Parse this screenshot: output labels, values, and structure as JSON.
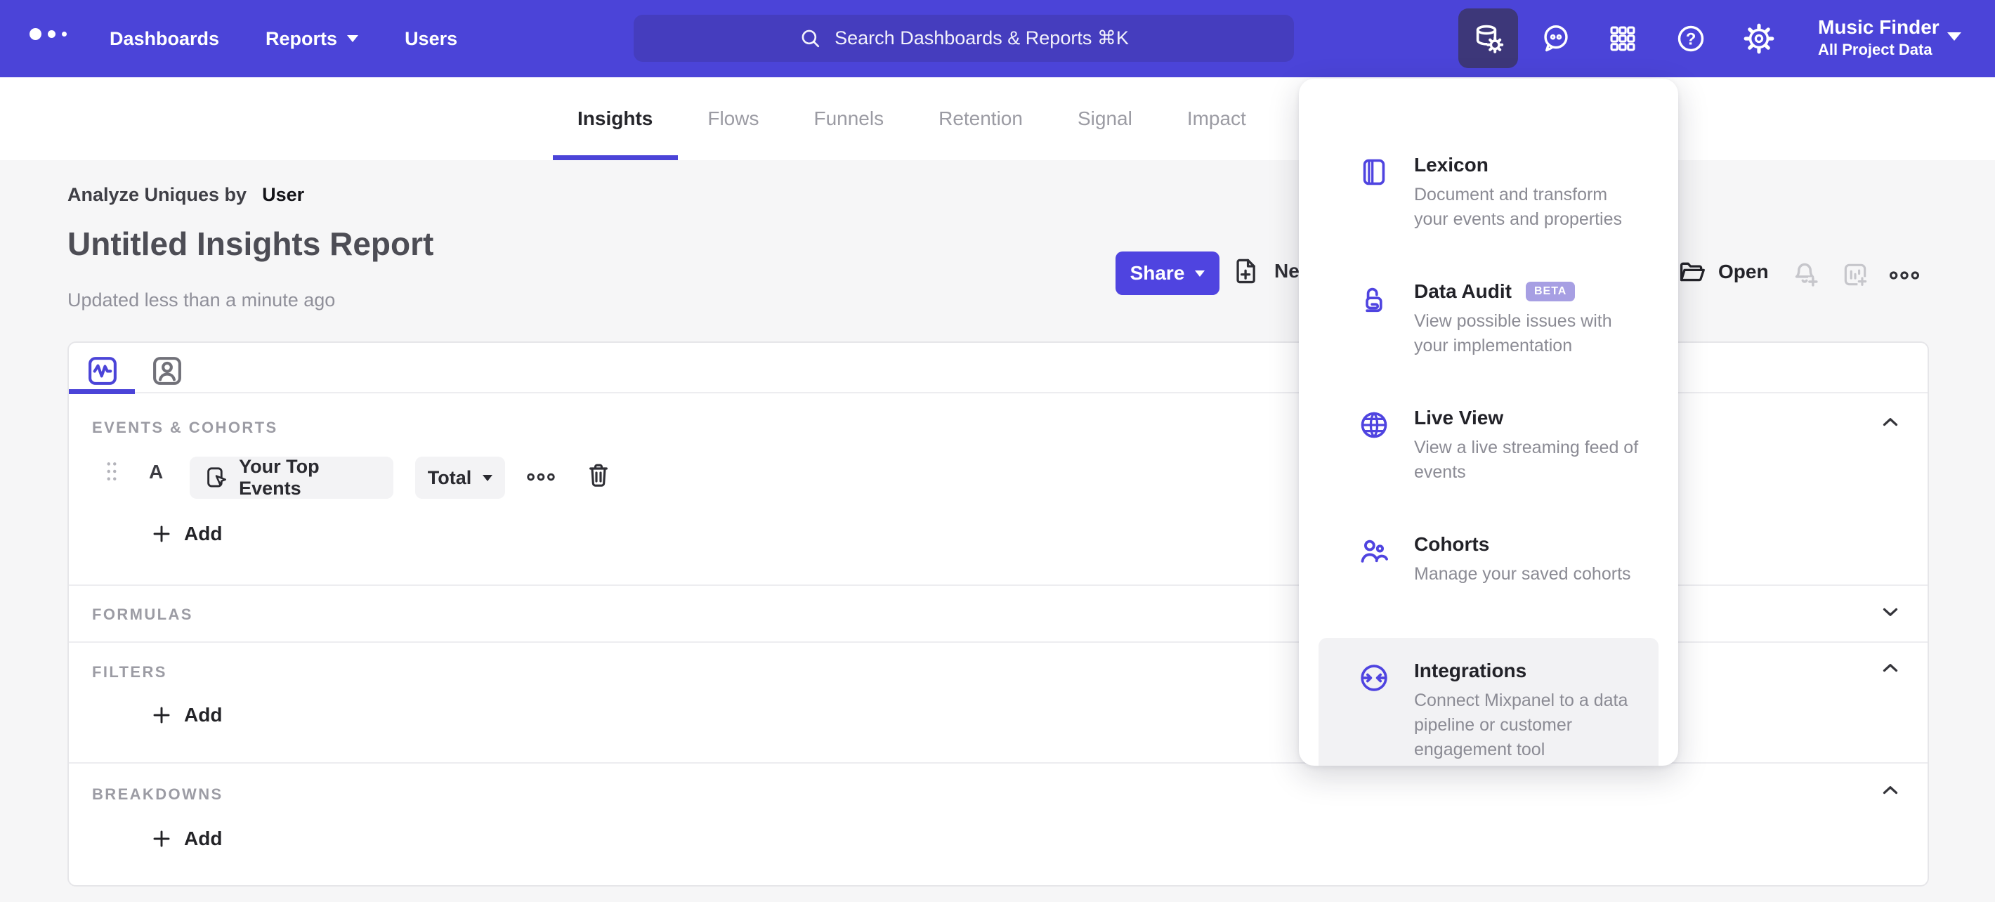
{
  "colors": {
    "topbar": "#4b44d8",
    "topbar_search": "#453dbe",
    "accent": "#4f44e0",
    "active_tile": "#3d3779",
    "beta_badge": "#a79fe3",
    "page_bg": "#f6f6f7"
  },
  "topbar": {
    "nav": [
      {
        "label": "Dashboards"
      },
      {
        "label": "Reports",
        "has_caret": true
      },
      {
        "label": "Users"
      }
    ],
    "search_placeholder": "Search Dashboards & Reports ⌘K",
    "icons": [
      "data-management-icon",
      "feedback-icon",
      "apps-grid-icon",
      "help-icon",
      "settings-icon"
    ],
    "project": {
      "name": "Music Finder",
      "scope": "All Project Data"
    }
  },
  "tabs": {
    "items": [
      {
        "label": "Insights",
        "active": true
      },
      {
        "label": "Flows"
      },
      {
        "label": "Funnels"
      },
      {
        "label": "Retention"
      },
      {
        "label": "Signal"
      },
      {
        "label": "Impact"
      }
    ]
  },
  "report_header": {
    "breadcrumb_prefix": "Analyze Uniques by",
    "breadcrumb_value": "User",
    "title": "Untitled Insights Report",
    "updated": "Updated less than a minute ago",
    "share_label": "Share",
    "new_label": "New",
    "open_label": "Open"
  },
  "query_builder": {
    "sections": {
      "events": {
        "label": "EVENTS & COHORTS",
        "row": {
          "series": "A",
          "event": "Your Top Events",
          "metric": "Total"
        },
        "add_label": "Add"
      },
      "formulas": {
        "label": "FORMULAS"
      },
      "filters": {
        "label": "FILTERS",
        "add_label": "Add"
      },
      "breakdowns": {
        "label": "BREAKDOWNS",
        "add_label": "Add"
      }
    }
  },
  "apps_menu": {
    "items": [
      {
        "icon": "lexicon-book-icon",
        "title": "Lexicon",
        "description": "Document and transform your events and properties"
      },
      {
        "icon": "data-audit-lock-icon",
        "title": "Data Audit",
        "badge": "BETA",
        "description": "View possible issues with your implementation"
      },
      {
        "icon": "live-view-globe-icon",
        "title": "Live View",
        "description": "View a live streaming feed of events"
      },
      {
        "icon": "cohorts-users-icon",
        "title": "Cohorts",
        "description": "Manage your saved cohorts"
      },
      {
        "icon": "integrations-sync-icon",
        "title": "Integrations",
        "description": "Connect Mixpanel to a data pipeline or customer engagement tool",
        "highlighted": true
      }
    ]
  }
}
